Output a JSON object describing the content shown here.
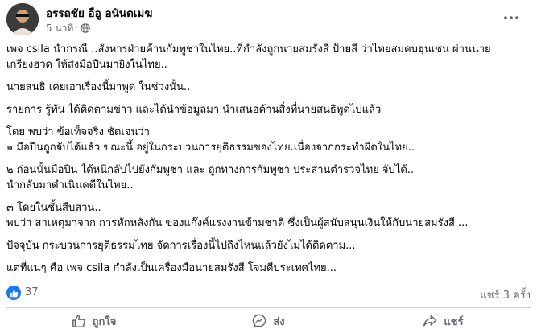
{
  "post": {
    "author": "อรรถชัย อือู อนันตเมฆ",
    "time": "5 นาที",
    "privacy_icon": "globe-icon",
    "more_icon": "more-options-icon",
    "paragraphs": [
      [
        "เพจ csila นำกรณี ..สังหารฝ่ายค้านกัมพูชาในไทย..ที่กำลังถูกนายสมรังสี ป้ายสี  ว่าไทยสมคบฮุนเซน ผ่านนาย",
        "เกรียงฮวด ให้ส่งมือปืนมายิงในไทย.."
      ],
      [
        "นายสนธิ เคยเอาเรื่องนี้มาพูด ในช่วงนั้น.."
      ],
      [
        "รายการ รู้ทัน ได้ติดตามข่าว และได้นำข้อมูลมา นำเสนอค้านสิ่งที่นายสนธิพูดไปแล้ว"
      ],
      [
        "โดย พบว่า  ข้อเท็จจริง ชัดเจนว่า",
        "๑ มือปืนถูกจับได้แล้ว ขณะนี้ อยู่ในกระบวนการยุติธรรมของไทย.เนื่องจากกระทำผิดในไทย.."
      ],
      [
        "๒ ก่อนนั้นมือปืน ได้หนีกลับไปยังกัมพูชา และ ถูกทางการกัมพูชา ประสานตำรวจไทย จับได้..",
        "นำกลับมาดำเนินคดีในไทย.."
      ],
      [
        "๓ โดยในชั้นสืบสวน..",
        "พบว่า สาเหตุมาจาก การหักหลังกัน ของแก๊งค์แรงงานข้ามชาติ  ซึ่งเป็นผู้สนับสนุนเงินให้กับนายสมรังสี ..."
      ],
      [
        "ปัจจุบัน กระบวนการยุติธรรมไทย จัดการเรื่องนี้ไปถึงไหนแล้วยังไม่ได้ติดตาม..."
      ],
      [
        "แต่ที่แน่ๆ คือ เพจ csila กำลังเป็นเครื่องมือนายสมรังสี โจมตีประเทศไทย..."
      ]
    ],
    "like_count": "37",
    "share_count": "แชร์ 3 ครั้ง",
    "reaction_icon": "like-reaction-icon"
  },
  "actions": {
    "like_label": "ถูกใจ",
    "comment_label": "ส่ง",
    "share_label": "แชร์",
    "like_icon": "thumbs-up-icon",
    "comment_icon": "messenger-icon",
    "share_icon": "share-arrow-icon"
  },
  "colors": {
    "text": "#050505",
    "secondary": "#65676b",
    "like_blue": "#1877f2",
    "divider": "#ced0d4"
  }
}
